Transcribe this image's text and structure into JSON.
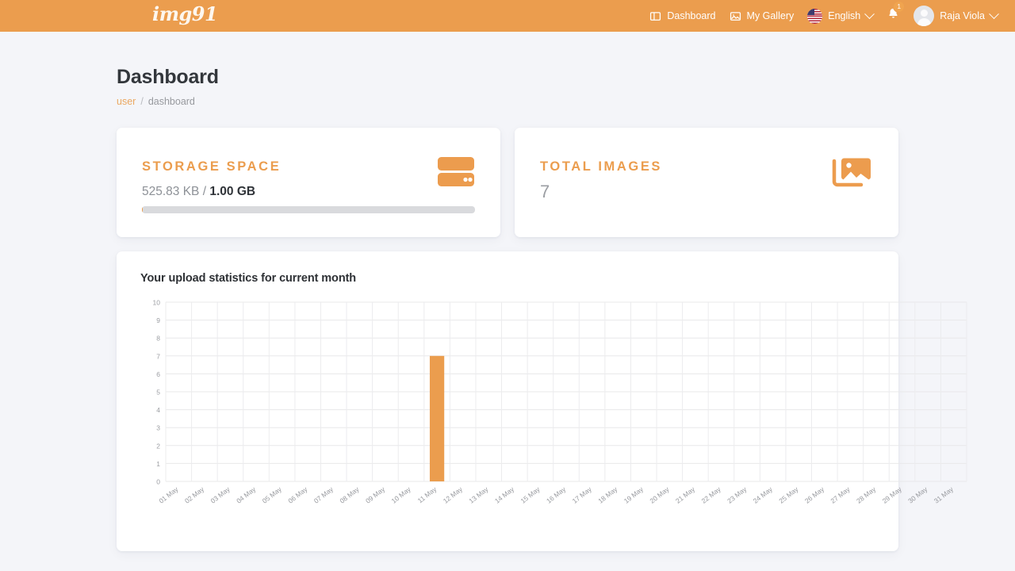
{
  "navbar": {
    "brand": "img91",
    "links": [
      {
        "label": "Dashboard",
        "icon": "dashboard-icon"
      },
      {
        "label": "My Gallery",
        "icon": "gallery-icon"
      }
    ],
    "language": {
      "label": "English",
      "flag": "us-flag-icon"
    },
    "notifications": {
      "count": "1",
      "icon": "bell-icon"
    },
    "user": {
      "name": "Raja Viola",
      "avatar": "avatar-icon"
    }
  },
  "page": {
    "title": "Dashboard",
    "breadcrumb": {
      "link": "user",
      "separator": "/",
      "current": "dashboard"
    }
  },
  "stats": {
    "storage": {
      "title": "STORAGE SPACE",
      "used": "525.83 KB",
      "divider": "/",
      "total": "1.00 GB",
      "progress_percent": 0.05,
      "icon": "hard-drive-icon",
      "accent": "#eb9d4e"
    },
    "images": {
      "title": "TOTAL IMAGES",
      "count": "7",
      "icon": "images-icon",
      "accent": "#eb9d4e"
    }
  },
  "chart_data": {
    "type": "bar",
    "title": "Your upload statistics for current month",
    "xlabel": "",
    "ylabel": "",
    "ylim": [
      0,
      10
    ],
    "ytick_labels": [
      "0",
      "1",
      "2",
      "3",
      "4",
      "5",
      "6",
      "7",
      "8",
      "9",
      "10"
    ],
    "grid": true,
    "legend": "none",
    "bar_color": "#eb9d4e",
    "categories": [
      "01 May",
      "02 May",
      "03 May",
      "04 May",
      "05 May",
      "06 May",
      "07 May",
      "08 May",
      "09 May",
      "10 May",
      "11 May",
      "12 May",
      "13 May",
      "14 May",
      "15 May",
      "16 May",
      "17 May",
      "18 May",
      "19 May",
      "20 May",
      "21 May",
      "22 May",
      "23 May",
      "24 May",
      "25 May",
      "26 May",
      "27 May",
      "28 May",
      "29 May",
      "30 May",
      "31 May"
    ],
    "values": [
      0,
      0,
      0,
      0,
      0,
      0,
      0,
      0,
      0,
      0,
      7,
      0,
      0,
      0,
      0,
      0,
      0,
      0,
      0,
      0,
      0,
      0,
      0,
      0,
      0,
      0,
      0,
      0,
      0,
      0,
      0
    ]
  }
}
